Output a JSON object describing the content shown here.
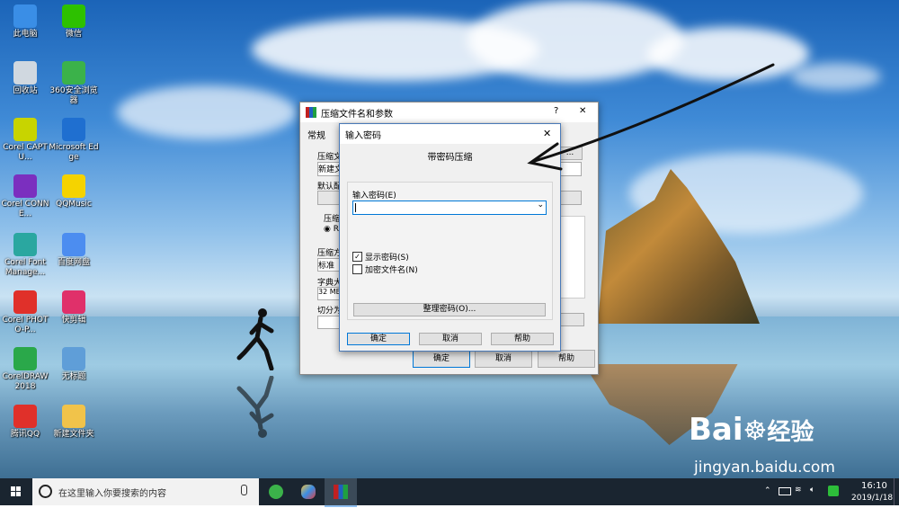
{
  "desktop_icons": [
    {
      "label": "此电脑",
      "icon": "pc-icon",
      "color": "#3a8ee6"
    },
    {
      "label": "微信",
      "icon": "wechat-icon",
      "color": "#2dc100"
    },
    {
      "label": "回收站",
      "icon": "recycle-bin-icon",
      "color": "#d0d8e0"
    },
    {
      "label": "360安全浏览器",
      "icon": "360-browser-icon",
      "color": "#3bb24a"
    },
    {
      "label": "Corel CAPTU...",
      "icon": "corel-capture-icon",
      "color": "#c8d400"
    },
    {
      "label": "Microsoft Edge",
      "icon": "edge-icon",
      "color": "#1f6fd0"
    },
    {
      "label": "Corel CONNE...",
      "icon": "corel-connect-icon",
      "color": "#7b2fbf"
    },
    {
      "label": "QQMusic",
      "icon": "qqmusic-icon",
      "color": "#f5d300"
    },
    {
      "label": "Corel Font Manage...",
      "icon": "corel-font-icon",
      "color": "#2aa7a0"
    },
    {
      "label": "百度网盘",
      "icon": "baidu-netdisk-icon",
      "color": "#4c8df0"
    },
    {
      "label": "Corel PHOTO-P...",
      "icon": "corel-photopaint-icon",
      "color": "#e0302a"
    },
    {
      "label": "快剪辑",
      "icon": "kuaijianji-icon",
      "color": "#e0306a"
    },
    {
      "label": "CorelDRAW 2018",
      "icon": "coreldraw-icon",
      "color": "#2aa84a"
    },
    {
      "label": "无标题",
      "icon": "untitled-icon",
      "color": "#5f9ed8"
    },
    {
      "label": "腾讯QQ",
      "icon": "qq-icon",
      "color": "#e0302a"
    },
    {
      "label": "新建文件夹",
      "icon": "folder-icon",
      "color": "#f1c34a"
    }
  ],
  "back_dialog": {
    "title": "压缩文件名和参数",
    "help_glyph": "?",
    "close_glyph": "✕",
    "tab": "常规",
    "archive_name_label": "压缩文",
    "archive_name_value": "新建文",
    "browse_label": "...",
    "default_config_label": "默认配",
    "format_label": "压缩",
    "format_option": "RA",
    "method_label": "压缩方",
    "method_value": "标准",
    "dict_label": "字典大",
    "dict_value": "32 MB",
    "split_label": "切分为",
    "ok": "确定",
    "cancel": "取消",
    "help": "帮助"
  },
  "password_dialog": {
    "title": "输入密码",
    "close_glyph": "✕",
    "heading": "带密码压缩",
    "password_label": "输入密码(E)",
    "password_value": "",
    "show_password_label": "显示密码(S)",
    "show_password_checked": true,
    "encrypt_names_label": "加密文件名(N)",
    "encrypt_names_checked": false,
    "organize_button": "整理密码(O)...",
    "ok": "确定",
    "cancel": "取消",
    "help": "帮助"
  },
  "taskbar": {
    "search_placeholder": "在这里输入你要搜索的内容",
    "time": "16:10",
    "date": "2019/1/18",
    "apps": [
      "360-browser-taskbar-icon",
      "paint-taskbar-icon",
      "winrar-taskbar-icon"
    ]
  },
  "watermark": {
    "brand": "Bai",
    "brand_cn": "经验",
    "url": "jingyan.baidu.com"
  }
}
